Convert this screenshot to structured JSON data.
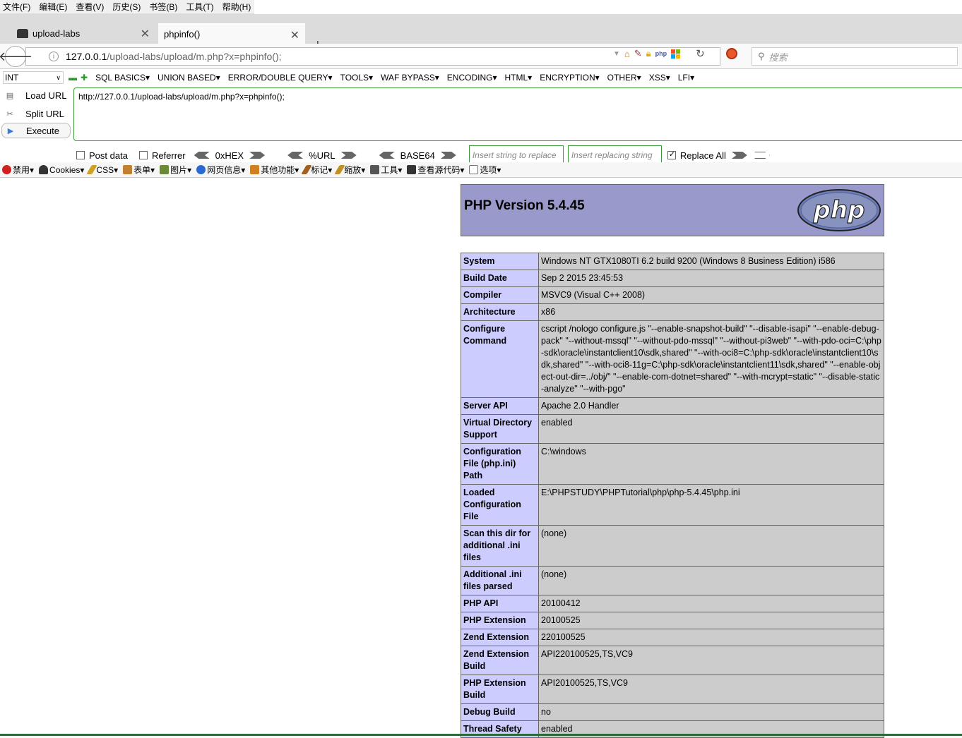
{
  "menubar": [
    "文件(F)",
    "编辑(E)",
    "查看(V)",
    "历史(S)",
    "书签(B)",
    "工具(T)",
    "帮助(H)"
  ],
  "tabs": [
    {
      "label": "upload-labs",
      "active": false
    },
    {
      "label": "phpinfo()",
      "active": true
    }
  ],
  "newtab_label": "+",
  "address": {
    "host": "127.0.0.1",
    "path": "/upload-labs/upload/m.php?x=phpinfo();"
  },
  "search": {
    "placeholder": "搜索"
  },
  "hackbar": {
    "type_select": "INT",
    "menus": [
      "SQL BASICS▾",
      "UNION BASED▾",
      "ERROR/DOUBLE QUERY▾",
      "TOOLS▾",
      "WAF BYPASS▾",
      "ENCODING▾",
      "HTML▾",
      "ENCRYPTION▾",
      "OTHER▾",
      "XSS▾",
      "LFI▾"
    ],
    "load_url": "Load URL",
    "split_url": "Split URL",
    "execute": "Execute",
    "url": "http://127.0.0.1/upload-labs/upload/m.php?x=phpinfo();",
    "post_data": "Post data",
    "referrer": "Referrer",
    "hex": "0xHEX",
    "urlenc": "%URL",
    "base64": "BASE64",
    "replace_placeholder": "Insert string to replace",
    "replacing_placeholder": "Insert replacing string",
    "replace_all": "Replace All"
  },
  "webdev": [
    "禁用▾",
    "Cookies▾",
    "CSS▾",
    "表单▾",
    "图片▾",
    "网页信息▾",
    "其他功能▾",
    "标记▾",
    "缩放▾",
    "工具▾",
    "查看源代码▾",
    "选项▾"
  ],
  "php": {
    "version": "PHP Version 5.4.45",
    "logo": "php",
    "rows": [
      {
        "k": "System",
        "v": "Windows NT GTX1080TI 6.2 build 9200 (Windows 8 Business Edition) i586"
      },
      {
        "k": "Build Date",
        "v": "Sep 2 2015 23:45:53"
      },
      {
        "k": "Compiler",
        "v": "MSVC9 (Visual C++ 2008)"
      },
      {
        "k": "Architecture",
        "v": "x86"
      },
      {
        "k": "Configure Command",
        "v": "cscript /nologo configure.js \"--enable-snapshot-build\" \"--disable-isapi\" \"--enable-debug-pack\" \"--without-mssql\" \"--without-pdo-mssql\" \"--without-pi3web\" \"--with-pdo-oci=C:\\php-sdk\\oracle\\instantclient10\\sdk,shared\" \"--with-oci8=C:\\php-sdk\\oracle\\instantclient10\\sdk,shared\" \"--with-oci8-11g=C:\\php-sdk\\oracle\\instantclient11\\sdk,shared\" \"--enable-object-out-dir=../obj/\" \"--enable-com-dotnet=shared\" \"--with-mcrypt=static\" \"--disable-static-analyze\" \"--with-pgo\""
      },
      {
        "k": "Server API",
        "v": "Apache 2.0 Handler"
      },
      {
        "k": "Virtual Directory Support",
        "v": "enabled"
      },
      {
        "k": "Configuration File (php.ini) Path",
        "v": "C:\\windows"
      },
      {
        "k": "Loaded Configuration File",
        "v": "E:\\PHPSTUDY\\PHPTutorial\\php\\php-5.4.45\\php.ini"
      },
      {
        "k": "Scan this dir for additional .ini files",
        "v": "(none)"
      },
      {
        "k": "Additional .ini files parsed",
        "v": "(none)"
      },
      {
        "k": "PHP API",
        "v": "20100412"
      },
      {
        "k": "PHP Extension",
        "v": "20100525"
      },
      {
        "k": "Zend Extension",
        "v": "220100525"
      },
      {
        "k": "Zend Extension Build",
        "v": "API220100525,TS,VC9"
      },
      {
        "k": "PHP Extension Build",
        "v": "API20100525,TS,VC9"
      },
      {
        "k": "Debug Build",
        "v": "no"
      },
      {
        "k": "Thread Safety",
        "v": "enabled"
      }
    ]
  }
}
